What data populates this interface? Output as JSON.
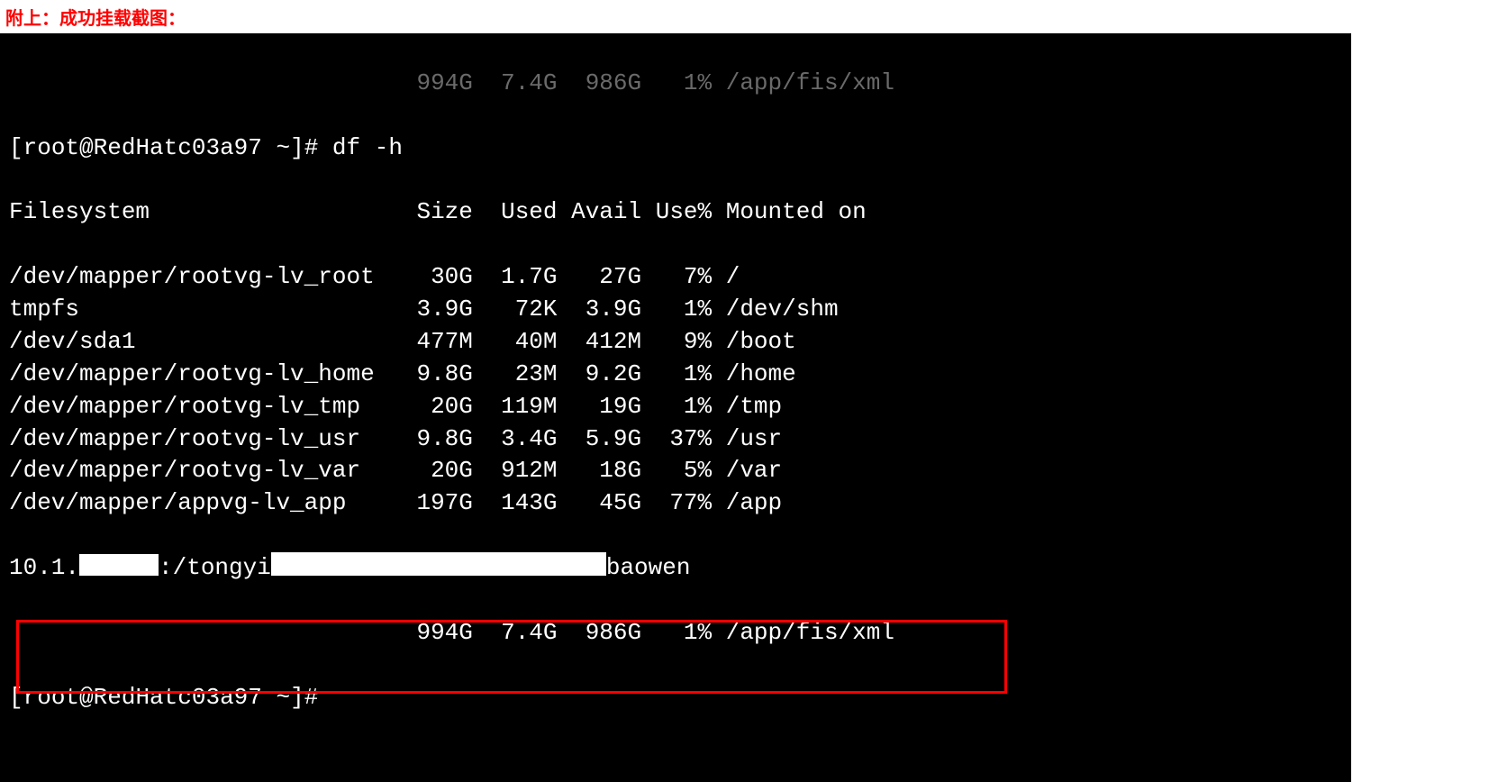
{
  "caption": "附上：成功挂载截图：",
  "fade_top": "                             994G  7.4G  986G   1% /app/fis/xml",
  "prompt_user": "root",
  "prompt_host": "RedHatc03a97",
  "prompt_path": "~",
  "command": "df -h",
  "header": "Filesystem                   Size  Used Avail Use% Mounted on",
  "entries": [
    {
      "fs": "/dev/mapper/rootvg-lv_root",
      "size": "30G",
      "used": "1.7G",
      "avail": "27G",
      "usep": "7%",
      "mount": "/"
    },
    {
      "fs": "tmpfs",
      "size": "3.9G",
      "used": "72K",
      "avail": "3.9G",
      "usep": "1%",
      "mount": "/dev/shm"
    },
    {
      "fs": "/dev/sda1",
      "size": "477M",
      "used": "40M",
      "avail": "412M",
      "usep": "9%",
      "mount": "/boot"
    },
    {
      "fs": "/dev/mapper/rootvg-lv_home",
      "size": "9.8G",
      "used": "23M",
      "avail": "9.2G",
      "usep": "1%",
      "mount": "/home"
    },
    {
      "fs": "/dev/mapper/rootvg-lv_tmp",
      "size": "20G",
      "used": "119M",
      "avail": "19G",
      "usep": "1%",
      "mount": "/tmp"
    },
    {
      "fs": "/dev/mapper/rootvg-lv_usr",
      "size": "9.8G",
      "used": "3.4G",
      "avail": "5.9G",
      "usep": "37%",
      "mount": "/usr"
    },
    {
      "fs": "/dev/mapper/rootvg-lv_var",
      "size": "20G",
      "used": "912M",
      "avail": "18G",
      "usep": "5%",
      "mount": "/var"
    },
    {
      "fs": "/dev/mapper/appvg-lv_app",
      "size": "197G",
      "used": "143G",
      "avail": "45G",
      "usep": "77%",
      "mount": "/app"
    }
  ],
  "nfs": {
    "fs_prefix": "10.1.",
    "fs_mid": ":/tongyi",
    "fs_suffix": "baowen",
    "size": "994G",
    "used": "7.4G",
    "avail": "986G",
    "usep": "1%",
    "mount": "/app/fis/xml"
  }
}
